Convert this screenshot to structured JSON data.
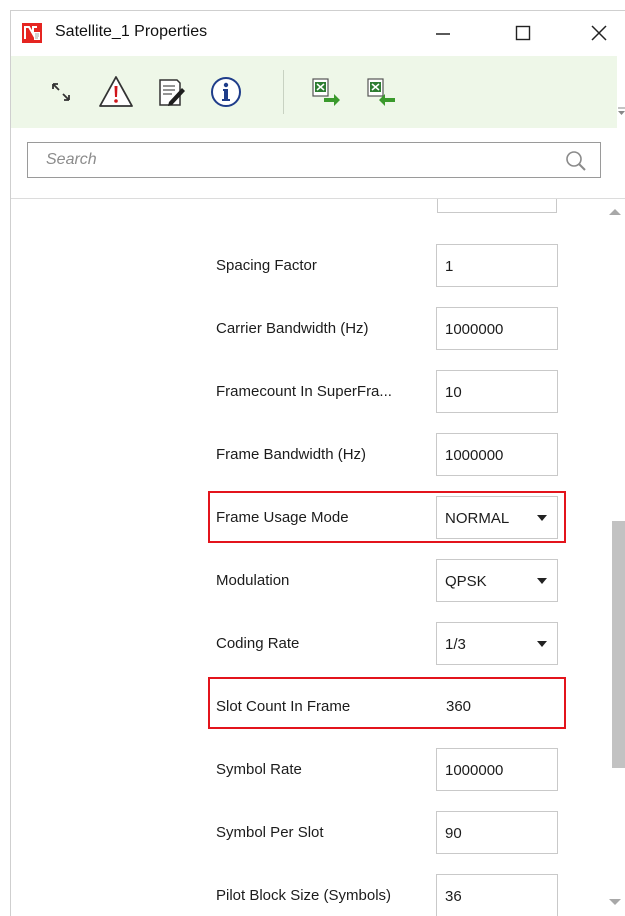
{
  "window": {
    "title": "Satellite_1 Properties",
    "controls": [
      "minimize-icon",
      "maximize-icon",
      "close-icon"
    ]
  },
  "toolbar": {
    "buttons": [
      {
        "icon": "expand-icon"
      },
      {
        "icon": "warning-icon"
      },
      {
        "icon": "edit-document-icon"
      },
      {
        "icon": "info-icon"
      },
      {
        "icon": "excel-export-icon"
      },
      {
        "icon": "excel-import-icon"
      }
    ],
    "accent": "#eef7e8"
  },
  "search": {
    "placeholder": "Search",
    "value": ""
  },
  "properties": [
    {
      "label": "Spacing Factor",
      "value": "1",
      "type": "input"
    },
    {
      "label": "Carrier Bandwidth (Hz)",
      "value": "1000000",
      "type": "input"
    },
    {
      "label": "Framecount In SuperFra...",
      "value": "10",
      "type": "input"
    },
    {
      "label": "Frame Bandwidth (Hz)",
      "value": "1000000",
      "type": "input"
    },
    {
      "label": "Frame Usage Mode",
      "value": "NORMAL",
      "type": "dropdown",
      "highlighted": true
    },
    {
      "label": "Modulation",
      "value": "QPSK",
      "type": "dropdown"
    },
    {
      "label": "Coding Rate",
      "value": "1/3",
      "type": "dropdown"
    },
    {
      "label": "Slot Count In Frame",
      "value": "360",
      "type": "readonly",
      "highlighted": true
    },
    {
      "label": "Symbol Rate",
      "value": "1000000",
      "type": "input"
    },
    {
      "label": "Symbol Per Slot",
      "value": "90",
      "type": "input"
    },
    {
      "label": "Pilot Block Size (Symbols)",
      "value": "36",
      "type": "input"
    }
  ],
  "colors": {
    "highlight": "#e3141c",
    "toolbar_bg": "#eef7e8",
    "scroll_thumb": "#c2c2c2"
  }
}
